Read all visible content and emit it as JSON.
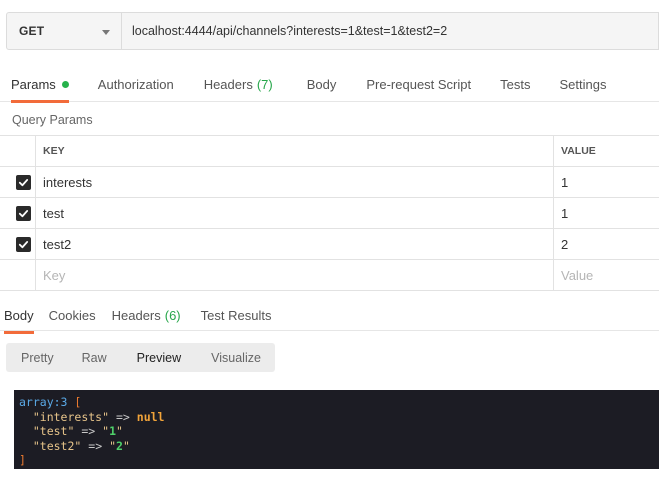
{
  "request": {
    "method": "GET",
    "url": "localhost:4444/api/channels?interests=1&test=1&test2=2"
  },
  "request_tabs": {
    "params": "Params",
    "authorization": "Authorization",
    "headers": "Headers",
    "headers_count": "(7)",
    "body": "Body",
    "prerequest": "Pre-request Script",
    "tests": "Tests",
    "settings": "Settings"
  },
  "query_params": {
    "title": "Query Params",
    "key_header": "KEY",
    "value_header": "VALUE",
    "rows": [
      {
        "key": "interests",
        "value": "1"
      },
      {
        "key": "test",
        "value": "1"
      },
      {
        "key": "test2",
        "value": "2"
      }
    ],
    "key_placeholder": "Key",
    "value_placeholder": "Value"
  },
  "response_tabs": {
    "body": "Body",
    "cookies": "Cookies",
    "headers": "Headers",
    "headers_count": "(6)",
    "test_results": "Test Results"
  },
  "view_modes": {
    "pretty": "Pretty",
    "raw": "Raw",
    "preview": "Preview",
    "visualize": "Visualize"
  },
  "output": {
    "line1_head": "array:3",
    "line1_bracket": "[",
    "entries": [
      {
        "key": "\"interests\"",
        "arrow": "=>",
        "value": "null"
      },
      {
        "key": "\"test\"",
        "arrow": "=>",
        "q1": "\"",
        "num": "1",
        "q2": "\""
      },
      {
        "key": "\"test2\"",
        "arrow": "=>",
        "q1": "\"",
        "num": "2",
        "q2": "\""
      }
    ],
    "close_bracket": "]"
  },
  "colors": {
    "accent": "#f26b3a",
    "status_green": "#26b24b",
    "output_bg": "#1c1c24"
  }
}
